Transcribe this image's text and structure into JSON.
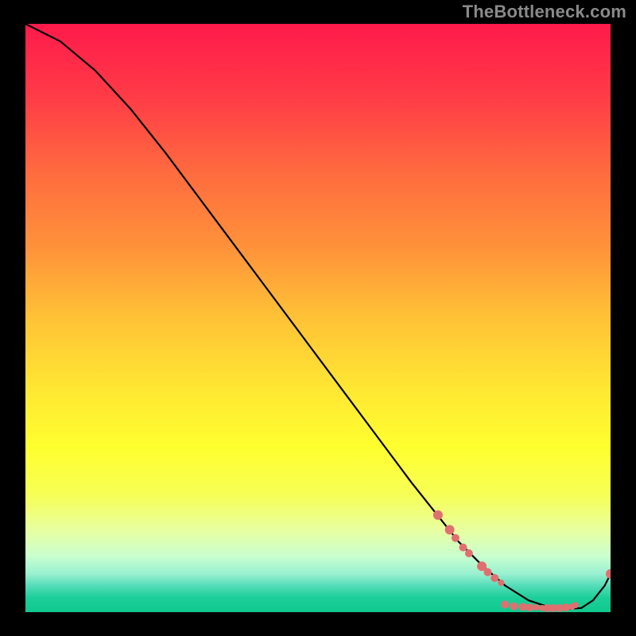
{
  "watermark": "TheBottleneck.com",
  "gradient_stops": [
    {
      "offset": 0.0,
      "color": "#ff1a4b"
    },
    {
      "offset": 0.12,
      "color": "#ff3a47"
    },
    {
      "offset": 0.25,
      "color": "#ff6a3f"
    },
    {
      "offset": 0.38,
      "color": "#ff923a"
    },
    {
      "offset": 0.5,
      "color": "#ffc236"
    },
    {
      "offset": 0.62,
      "color": "#ffe733"
    },
    {
      "offset": 0.72,
      "color": "#ffff2f"
    },
    {
      "offset": 0.8,
      "color": "#f7ff55"
    },
    {
      "offset": 0.86,
      "color": "#e8ffa0"
    },
    {
      "offset": 0.905,
      "color": "#c9ffcf"
    },
    {
      "offset": 0.935,
      "color": "#99f0d0"
    },
    {
      "offset": 0.955,
      "color": "#55dcb8"
    },
    {
      "offset": 0.975,
      "color": "#1ccf9a"
    },
    {
      "offset": 1.0,
      "color": "#0fc98e"
    }
  ],
  "chart_data": {
    "type": "line",
    "title": "",
    "xlabel": "",
    "ylabel": "",
    "xlim": [
      0,
      100
    ],
    "ylim": [
      0,
      100
    ],
    "series": [
      {
        "name": "curve",
        "x": [
          0,
          6,
          12,
          18,
          24,
          30,
          36,
          42,
          48,
          54,
          60,
          66,
          70,
          74,
          78,
          82,
          86,
          89,
          92,
          95,
          97,
          99,
          100
        ],
        "y": [
          100,
          97,
          92,
          85.5,
          78,
          70,
          62,
          54,
          46,
          38,
          30,
          22,
          17,
          12,
          8,
          4.5,
          2,
          1,
          0.5,
          0.7,
          2,
          4.5,
          6.5
        ]
      }
    ],
    "markers": [
      {
        "x": 70.5,
        "y": 16.5,
        "r": 6
      },
      {
        "x": 72.5,
        "y": 14.0,
        "r": 6
      },
      {
        "x": 73.5,
        "y": 12.6,
        "r": 5
      },
      {
        "x": 74.8,
        "y": 11.0,
        "r": 5
      },
      {
        "x": 75.8,
        "y": 10.0,
        "r": 5
      },
      {
        "x": 78.0,
        "y": 7.8,
        "r": 6
      },
      {
        "x": 79.0,
        "y": 6.8,
        "r": 5
      },
      {
        "x": 80.2,
        "y": 5.8,
        "r": 5
      },
      {
        "x": 81.3,
        "y": 5.0,
        "r": 4
      },
      {
        "x": 82.0,
        "y": 1.3,
        "r": 5
      },
      {
        "x": 83.5,
        "y": 1.0,
        "r": 5
      },
      {
        "x": 85.0,
        "y": 0.9,
        "r": 5
      },
      {
        "x": 86.2,
        "y": 0.8,
        "r": 5
      },
      {
        "x": 87.3,
        "y": 0.8,
        "r": 4
      },
      {
        "x": 88.3,
        "y": 0.7,
        "r": 4
      },
      {
        "x": 89.2,
        "y": 0.7,
        "r": 5
      },
      {
        "x": 90.2,
        "y": 0.7,
        "r": 5
      },
      {
        "x": 91.3,
        "y": 0.7,
        "r": 5
      },
      {
        "x": 92.4,
        "y": 0.8,
        "r": 5
      },
      {
        "x": 93.4,
        "y": 0.9,
        "r": 4
      },
      {
        "x": 94.0,
        "y": 1.2,
        "r": 4
      },
      {
        "x": 100.0,
        "y": 6.5,
        "r": 6
      }
    ]
  }
}
